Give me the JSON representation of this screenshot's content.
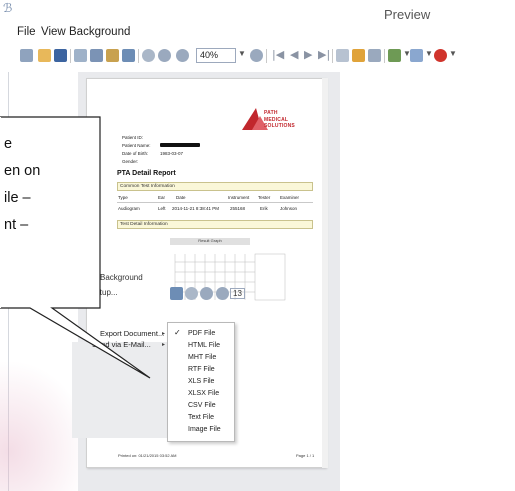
{
  "window": {
    "title": "Preview",
    "app_icon": "app-logo-icon"
  },
  "menubar": {
    "items": [
      "File",
      "View",
      "Background"
    ]
  },
  "toolbar": {
    "zoom_value": "40%"
  },
  "report": {
    "brand_lines": [
      "PATH",
      "MEDICAL",
      "SOLUTIONS"
    ],
    "patient_fields": [
      {
        "label": "Patient ID:",
        "value": ""
      },
      {
        "label": "Patient Name:",
        "value": ""
      },
      {
        "label": "Date of Birth:",
        "value": "1983-03-07"
      },
      {
        "label": "Gender:",
        "value": ""
      }
    ],
    "title": "PTA Detail Report",
    "sections": {
      "common": "Common Test Information",
      "detail": "Test Detail Information"
    },
    "table_headers": [
      "Type",
      "Ear",
      "Date",
      "Instrument",
      "Tester",
      "Examiner"
    ],
    "table_row": [
      "Audiogram",
      "Left",
      "2014-11-21 8:38:41 PM",
      "255168",
      "Erik",
      "Johnson"
    ],
    "chart_header": "Result Graph",
    "footer_left": "Printed on: 01/21/2015 03:52 AM",
    "footer_right": "Page 1 / 1"
  },
  "popup": {
    "menu_label": "Background",
    "setup_label": "Setup...",
    "zoom_label": "13",
    "menu_items": [
      {
        "label": "Export Document...",
        "has_submenu": true
      },
      {
        "label": "Send via E-Mail...",
        "has_submenu": true
      }
    ],
    "export_options": [
      "PDF File",
      "HTML File",
      "MHT File",
      "RTF File",
      "XLS File",
      "XLSX File",
      "CSV File",
      "Text File",
      "Image File"
    ],
    "selected_option": "PDF File"
  },
  "callout": {
    "lines": [
      "e",
      "en on",
      "ile –",
      "nt –"
    ]
  }
}
